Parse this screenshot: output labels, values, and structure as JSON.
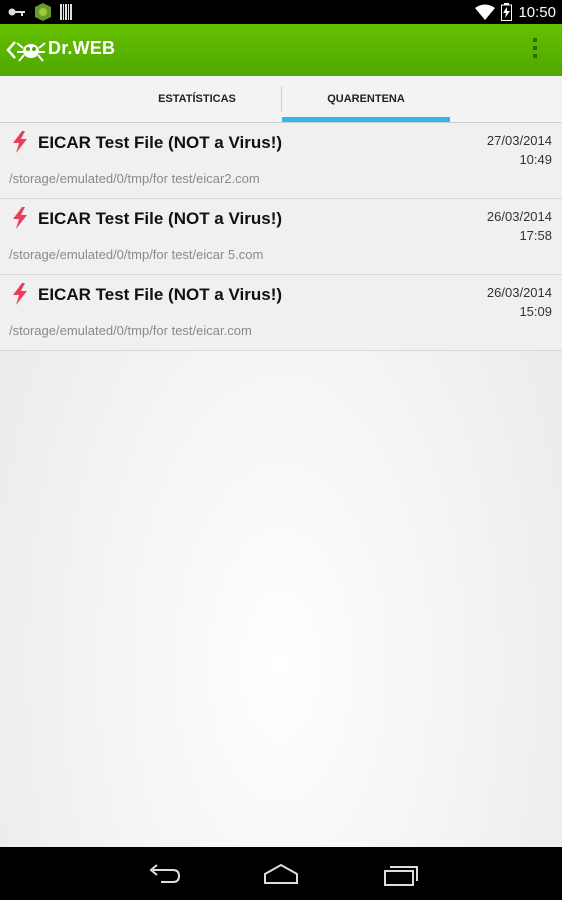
{
  "status_bar": {
    "time": "10:50"
  },
  "app": {
    "title": "Dr.WEB"
  },
  "tabs": [
    {
      "label": "ESTATÍSTICAS",
      "selected": false
    },
    {
      "label": "QUARENTENA",
      "selected": true
    }
  ],
  "items": [
    {
      "name": "EICAR Test File (NOT a Virus!)",
      "date": "27/03/2014",
      "time": "10:49",
      "path": "/storage/emulated/0/tmp/for test/eicar2.com"
    },
    {
      "name": "EICAR Test File (NOT a Virus!)",
      "date": "26/03/2014",
      "time": "17:58",
      "path": "/storage/emulated/0/tmp/for test/eicar 5.com"
    },
    {
      "name": "EICAR Test File (NOT a Virus!)",
      "date": "26/03/2014",
      "time": "15:09",
      "path": "/storage/emulated/0/tmp/for test/eicar.com"
    }
  ],
  "colors": {
    "actionbar": "#5cb800",
    "tab_indicator": "#33b5e5",
    "threat_icon": "#e8405a"
  },
  "icons": [
    "key-icon",
    "app-notification-icon",
    "barcode-icon",
    "wifi-icon",
    "battery-charging-icon",
    "back-arrow-icon",
    "drweb-spider-logo",
    "overflow-menu-icon",
    "lightning-bolt-icon",
    "nav-back-icon",
    "nav-home-icon",
    "nav-recent-apps-icon"
  ]
}
